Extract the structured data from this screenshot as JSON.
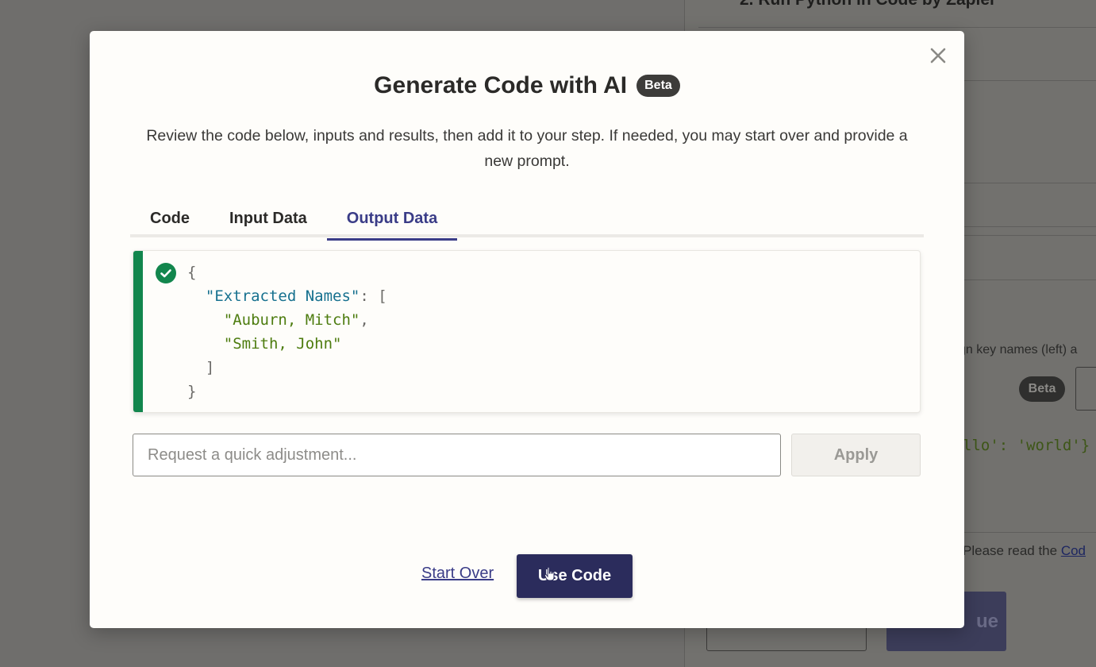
{
  "background": {
    "step_title": "2. Run Python in Code by Zapier",
    "hint_text": "gn key names (left) a",
    "beta_label": "Beta",
    "code_snippet": "llo': 'world'}",
    "note_text": "Please read the ",
    "note_link": "Cod",
    "continue_label": "ue"
  },
  "modal": {
    "title": "Generate Code with AI",
    "badge": "Beta",
    "description": "Review the code below, inputs and results, then add it to your step. If needed, you may start over and provide a new prompt.",
    "tabs": [
      {
        "label": "Code",
        "active": false
      },
      {
        "label": "Input Data",
        "active": false
      },
      {
        "label": "Output Data",
        "active": true
      }
    ],
    "output": {
      "status_icon": "check-circle-icon",
      "open_brace": "{",
      "key": "\"Extracted Names\"",
      "colon_bracket": ": [",
      "values": [
        "\"Auburn, Mitch\"",
        "\"Smith, John\""
      ],
      "close_bracket": "]",
      "close_brace": "}"
    },
    "adjustment": {
      "placeholder": "Request a quick adjustment...",
      "value": "",
      "apply_label": "Apply"
    },
    "footer": {
      "start_over_label": "Start Over",
      "use_code_label": "Use Code"
    }
  },
  "colors": {
    "accent": "#3a3c87",
    "primary_button": "#2b2c5c",
    "success": "#12864d",
    "json_key": "#17718f",
    "json_string": "#4d7c0f"
  }
}
